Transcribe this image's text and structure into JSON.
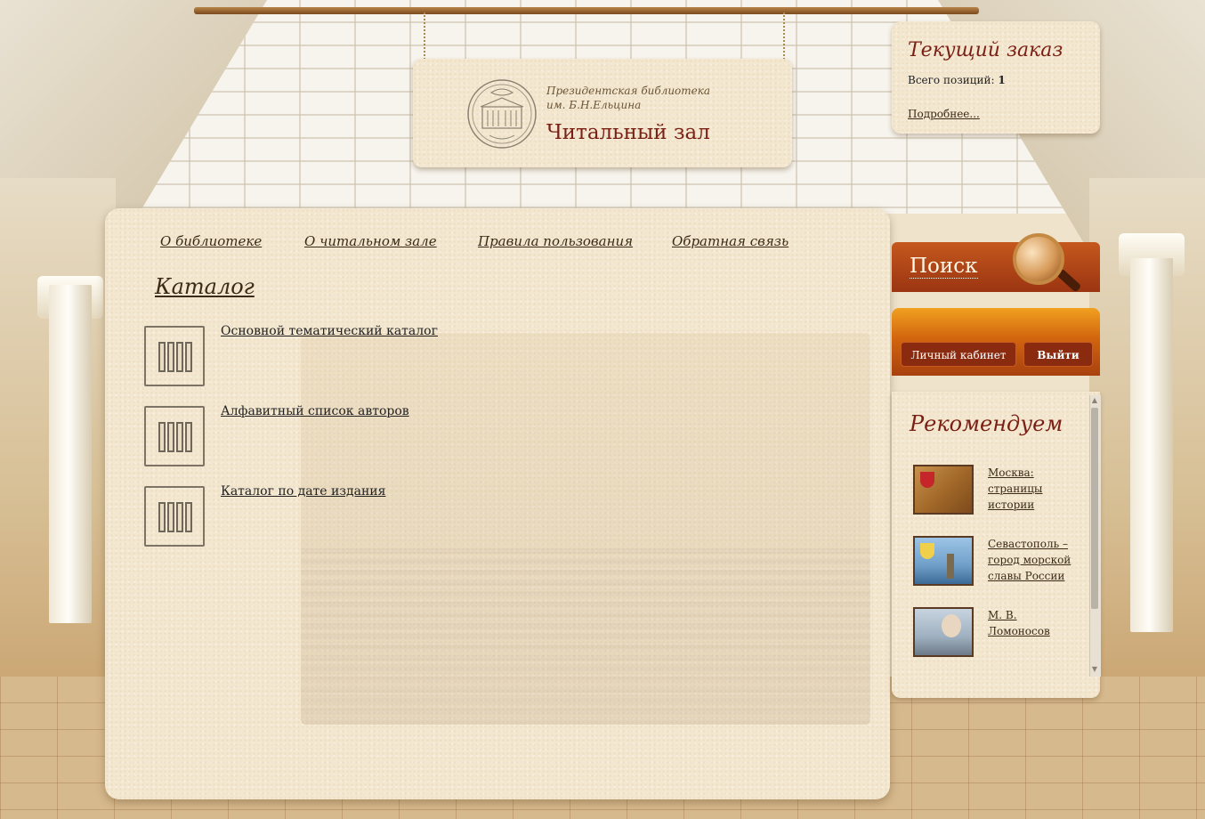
{
  "sign": {
    "subtitle": "Президентская библиотека\nим. Б.Н.Ельцина",
    "title": "Читальный зал"
  },
  "order": {
    "title": "Текущий заказ",
    "count_label": "Всего позиций: ",
    "count_value": "1",
    "more_link": "Подробнее..."
  },
  "nav": {
    "items": [
      "О библиотеке",
      "О читальном зале",
      "Правила пользования",
      "Обратная связь"
    ]
  },
  "catalog": {
    "heading": "Каталог",
    "items": [
      "Основной тематический каталог",
      "Алфавитный список авторов",
      "Каталог по дате издания"
    ]
  },
  "sidebar": {
    "search_label": "Поиск",
    "cabinet_button": "Личный кабинет",
    "logout_button": "Выйти",
    "recommend_title": "Рекомендуем",
    "recommendations": [
      "Москва: страницы истории",
      "Севастополь – город морской славы России",
      "М. В. Ломоносов"
    ]
  },
  "colors": {
    "accent_dark_red": "#7a1f14",
    "search_bar": "#b4481a",
    "user_bar": "#e07f14",
    "button": "#8a2a0e",
    "paper": "#f3e7cf"
  }
}
